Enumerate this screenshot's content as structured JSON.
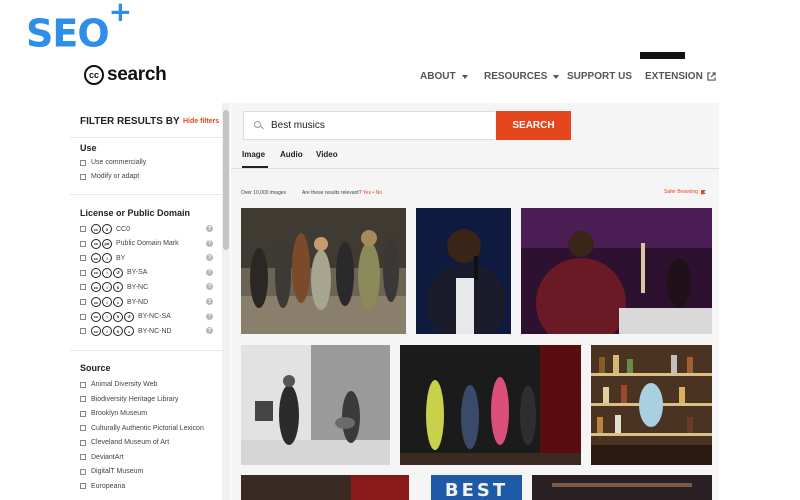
{
  "watermark": {
    "text": "SEO",
    "plus": "+"
  },
  "header": {
    "logo_mark": "cc",
    "logo_word": "search",
    "nav": [
      {
        "label": "ABOUT",
        "dropdown": true
      },
      {
        "label": "RESOURCES",
        "dropdown": true
      },
      {
        "label": "SUPPORT US",
        "dropdown": false
      },
      {
        "label": "EXTENSION",
        "external": true
      }
    ]
  },
  "sidebar": {
    "title": "FILTER RESULTS BY",
    "hide_label": "Hide filters",
    "use": {
      "heading": "Use",
      "options": [
        "Use commercially",
        "Modify or adapt"
      ]
    },
    "license": {
      "heading": "License or Public Domain",
      "options": [
        {
          "label": "CC0",
          "icons": [
            "cc",
            "0"
          ]
        },
        {
          "label": "Public Domain Mark",
          "icons": [
            "cc",
            "pd"
          ]
        },
        {
          "label": "BY",
          "icons": [
            "cc",
            "by"
          ]
        },
        {
          "label": "BY-SA",
          "icons": [
            "cc",
            "by",
            "sa"
          ]
        },
        {
          "label": "BY-NC",
          "icons": [
            "cc",
            "by",
            "nc"
          ]
        },
        {
          "label": "BY-ND",
          "icons": [
            "cc",
            "by",
            "nd"
          ]
        },
        {
          "label": "BY-NC-SA",
          "icons": [
            "cc",
            "by",
            "nc",
            "sa"
          ]
        },
        {
          "label": "BY-NC-ND",
          "icons": [
            "cc",
            "by",
            "nc",
            "nd"
          ]
        }
      ]
    },
    "source": {
      "heading": "Source",
      "options": [
        "Animal Diversity Web",
        "Biodiversity Heritage Library",
        "Brooklyn Museum",
        "Culturally Authentic Pictorial Lexicon",
        "Cleveland Museum of Art",
        "DeviantArt",
        "DigitalT Museum",
        "Europeana"
      ]
    }
  },
  "search": {
    "value": "Best musics",
    "button_label": "SEARCH"
  },
  "tabs": [
    "Image",
    "Audio",
    "Video"
  ],
  "results": {
    "count_text": "Over 10,000 images",
    "relevance_question": "Are these results relevant?",
    "yes": "Yes",
    "separator": "•",
    "no": "No",
    "safer_browsing": "Safer Browsing"
  },
  "colors": {
    "accent": "#e5461d",
    "watermark_blue": "#2f8ee8",
    "main_bg": "#f5f5f5"
  },
  "images": [
    {
      "name": "street-crowd-photo"
    },
    {
      "name": "singer-microphone-photo"
    },
    {
      "name": "performer-stage-photo"
    },
    {
      "name": "street-musicians-photo"
    },
    {
      "name": "dancers-stage-photo"
    },
    {
      "name": "bar-shelves-photo"
    },
    {
      "name": "partial-photo-1"
    },
    {
      "name": "best-sign-photo",
      "overlay_text": "BEST"
    },
    {
      "name": "partial-photo-3"
    }
  ]
}
